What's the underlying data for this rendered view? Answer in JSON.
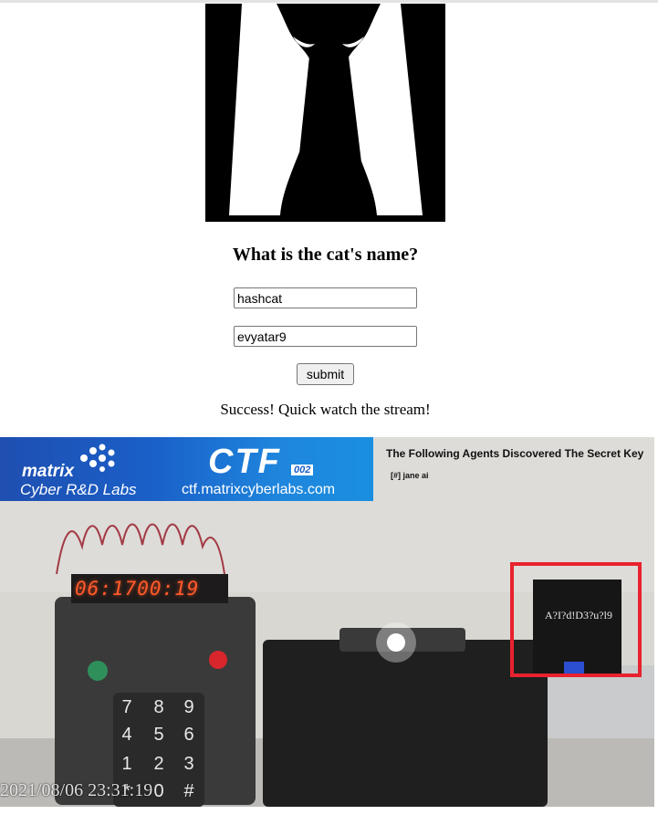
{
  "page": {
    "question": "What is the cat's name?",
    "inputs": {
      "first_value": "hashcat",
      "second_value": "evyatar9"
    },
    "submit_label": "submit",
    "status_message": "Success! Quick watch the stream!"
  },
  "stream": {
    "brand": {
      "name": "matrix",
      "tagline": "Cyber R&D Labs",
      "event": "CTF",
      "edition": "002",
      "url": "ctf.matrixcyberlabs.com"
    },
    "agents_title": "The Following Agents Discovered The Secret Key",
    "agents": [
      "[#] jane ai"
    ],
    "display_digits": "06:1700:19",
    "keypad_keys": [
      "7",
      "8",
      "9",
      "4",
      "5",
      "6",
      "1",
      "2",
      "3",
      "*",
      "0",
      "#"
    ],
    "secret_key_card": "A?I?d!D3?u?l9",
    "timestamp": "2021/08/06 23:31:19",
    "highlight_color": "#e8222e"
  },
  "colors": {
    "led_red": "#ff5a2a",
    "banner_blue": "#1a5fc8"
  }
}
